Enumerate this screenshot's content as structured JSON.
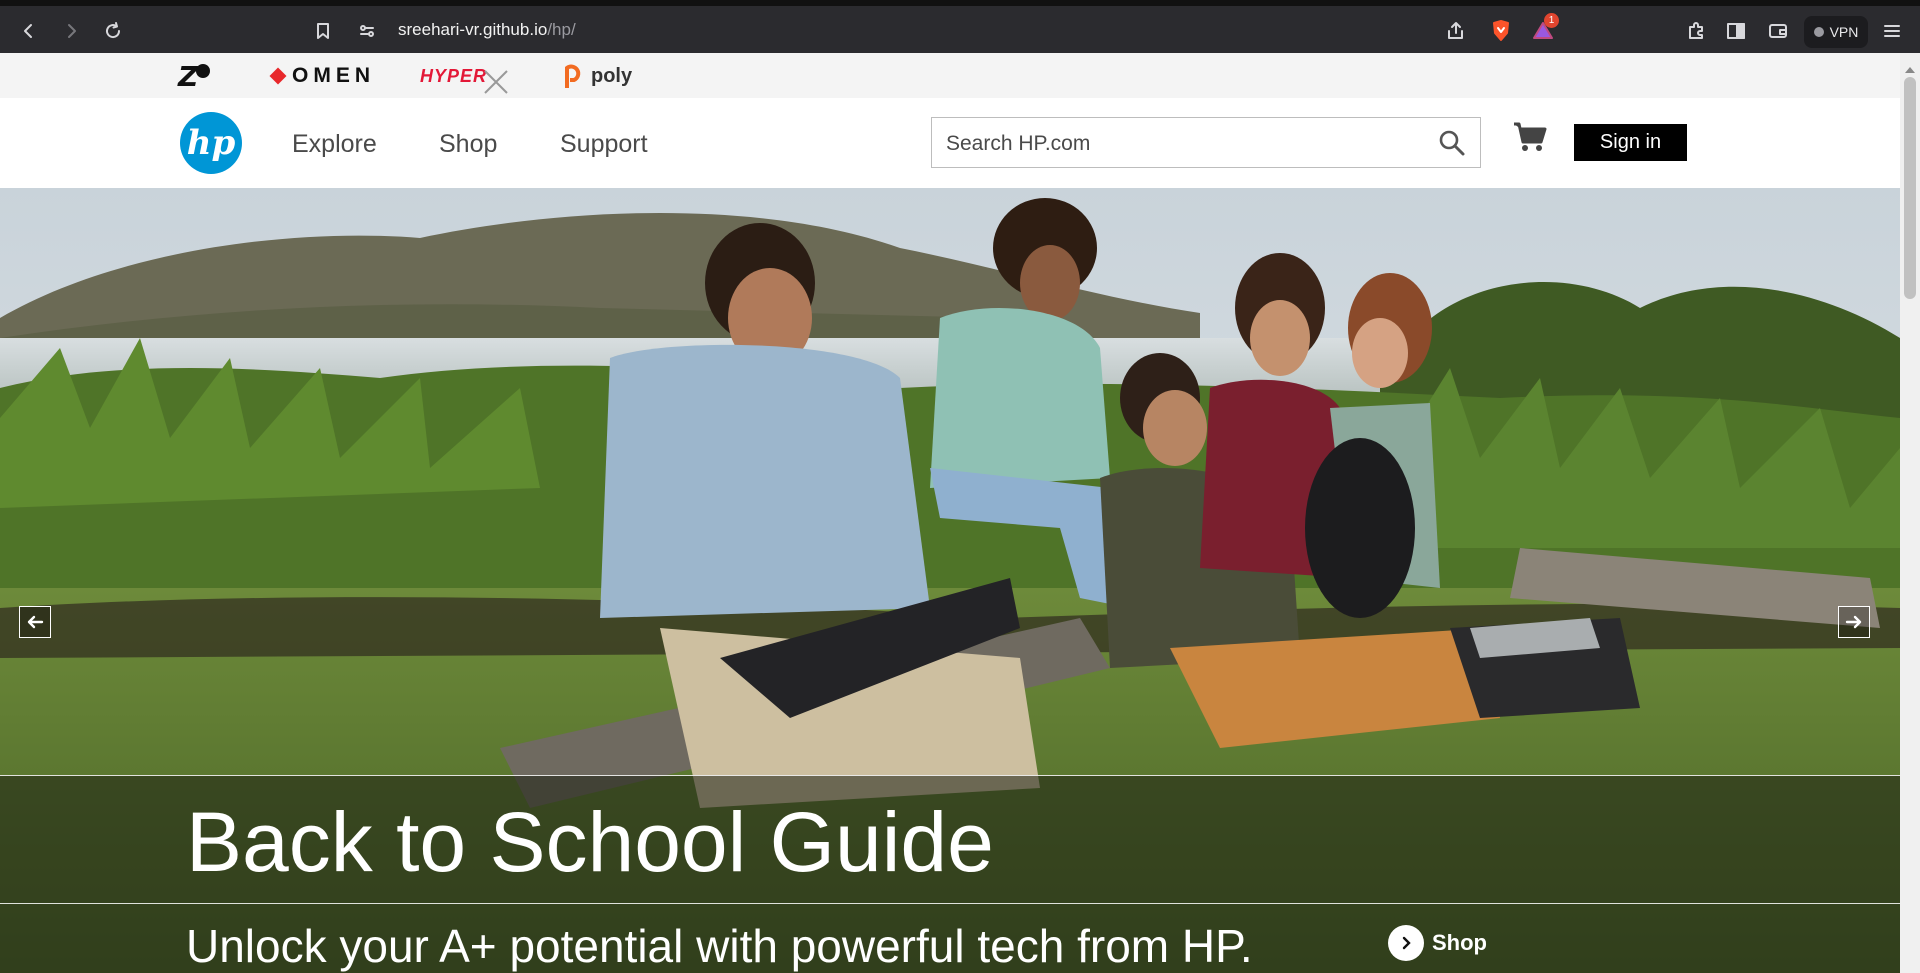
{
  "browser": {
    "url_host": "sreehari-vr.github.io",
    "url_path": "/hp/",
    "notification_count": "1",
    "vpn_label": "VPN"
  },
  "brands": {
    "z_label": "Z",
    "omen_label": "OMEN",
    "hyperx_label": "HYPER",
    "poly_label": "poly"
  },
  "header": {
    "logo_text": "hp",
    "nav": [
      "Explore",
      "Shop",
      "Support"
    ],
    "search_placeholder": "Search HP.com",
    "signin_label": "Sign in"
  },
  "hero": {
    "title": "Back to School Guide",
    "subtitle": "Unlock your A+ potential with powerful tech from HP.",
    "shop_label": "Shop"
  },
  "colors": {
    "hp_blue": "#0096d6",
    "signin_bg": "#000000",
    "omen_red": "#e8282b",
    "hyperx_red": "#e31837",
    "poly_orange": "#f26b21"
  }
}
